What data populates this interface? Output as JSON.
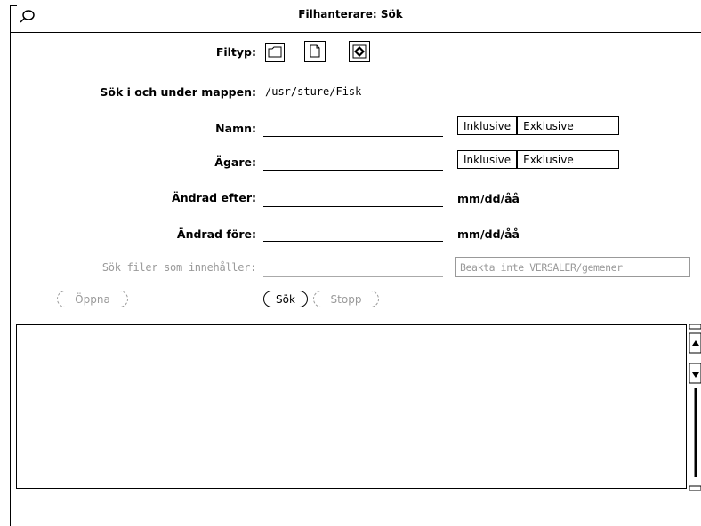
{
  "window": {
    "title": "Filhanterare: Sök"
  },
  "filetype": {
    "label": "Filtyp:",
    "icons": [
      "folder-icon",
      "document-icon",
      "application-icon"
    ]
  },
  "search_dir": {
    "label": "Sök i och under mappen:",
    "value": "/usr/sture/Fisk"
  },
  "name_row": {
    "label": "Namn:",
    "value": "",
    "options": [
      "Inklusive",
      "Exklusive"
    ],
    "selected": "Inklusive"
  },
  "owner_row": {
    "label": "Ägare:",
    "value": "",
    "options": [
      "Inklusive",
      "Exklusive"
    ],
    "selected": "Inklusive"
  },
  "modified_after": {
    "label": "Ändrad efter:",
    "value": "",
    "format": "mm/dd/åå"
  },
  "modified_before": {
    "label": "Ändrad före:",
    "value": "",
    "format": "mm/dd/åå"
  },
  "contains": {
    "label": "Sök filer som innehåller:",
    "value": "",
    "case_option": "Beakta inte VERSALER/gemener"
  },
  "buttons": {
    "open": "Öppna",
    "search": "Sök",
    "stop": "Stopp"
  },
  "results": []
}
